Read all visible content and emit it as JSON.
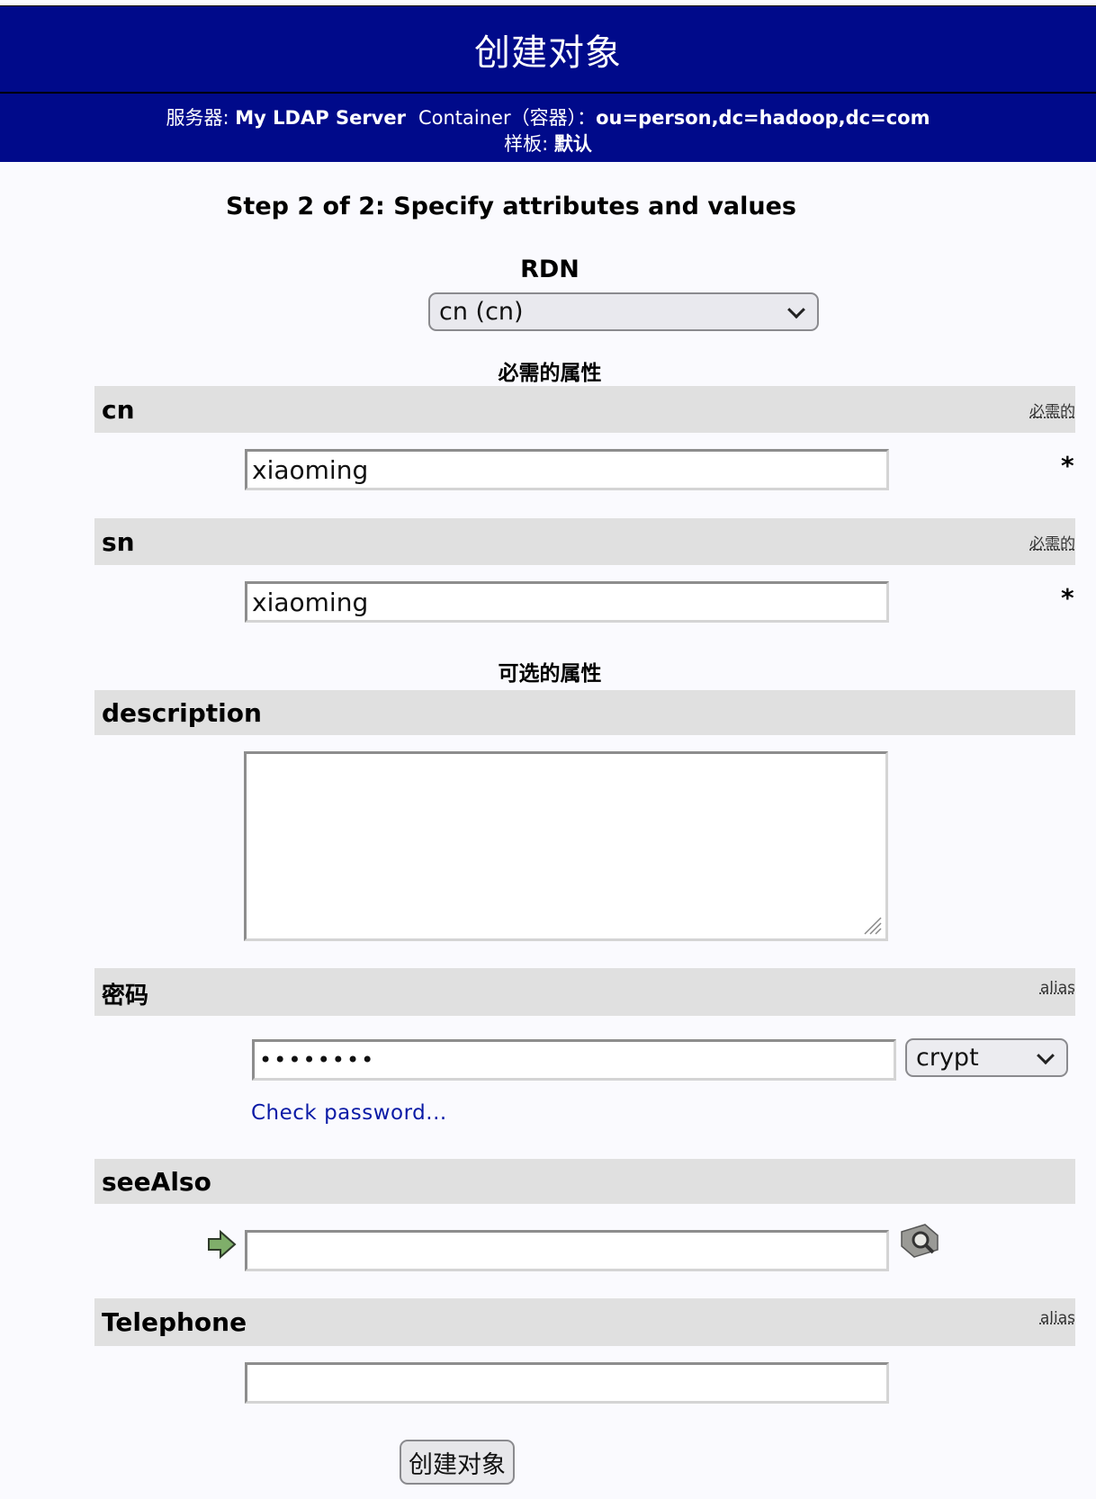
{
  "header": {
    "title": "创建对象",
    "server_label": "服务器:",
    "server_value": "My LDAP Server",
    "container_label": "Container（容器）：",
    "container_value": "ou=person,dc=hadoop,dc=com",
    "template_label": "样板:",
    "template_value": "默认"
  },
  "step_title": "Step 2 of 2: Specify attributes and values",
  "rdn": {
    "label": "RDN",
    "selected": "cn (cn)"
  },
  "required_section": "必需的属性",
  "optional_section": "可选的属性",
  "attributes": {
    "cn": {
      "name": "cn",
      "tag": "必需的",
      "value": "xiaoming",
      "star": "*"
    },
    "sn": {
      "name": "sn",
      "tag": "必需的",
      "value": "xiaoming",
      "star": "*"
    },
    "description": {
      "name": "description",
      "value": ""
    },
    "password": {
      "name": "密码",
      "tag": "alias",
      "value": "••••••••",
      "hash": "crypt",
      "check_link": "Check password..."
    },
    "seeAlso": {
      "name": "seeAlso",
      "value": ""
    },
    "telephone": {
      "name": "Telephone",
      "tag": "alias",
      "value": ""
    }
  },
  "submit_label": "创建对象",
  "icons": [
    "arrow-right-icon",
    "search-lookup-icon",
    "chevron-down-icon",
    "resize-grip-icon"
  ]
}
